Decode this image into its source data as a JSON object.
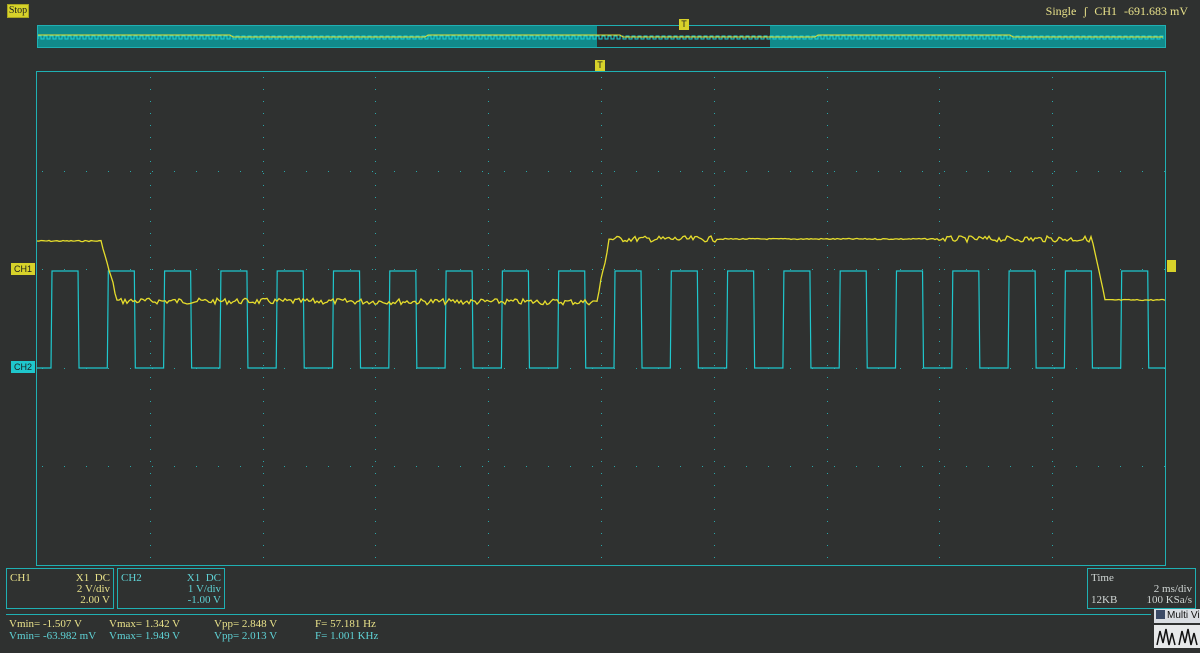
{
  "status": "Stop",
  "trigger": {
    "mode": "Single",
    "edge_icon": "rising-edge-icon",
    "source": "CH1",
    "level": "-691.683 mV"
  },
  "markers": {
    "trigger": "T",
    "ch1": "CH1",
    "ch2": "CH2"
  },
  "ch1": {
    "label": "CH1",
    "probe": "X1",
    "coupling": "DC",
    "scale": "2 V/div",
    "offset": "2.00 V",
    "color": "#e6dd2c"
  },
  "ch2": {
    "label": "CH2",
    "probe": "X1",
    "coupling": "DC",
    "scale": "1 V/div",
    "offset": "-1.00 V",
    "color": "#1fc7cc"
  },
  "time": {
    "label": "Time",
    "scale": "2 ms/div",
    "memory": "12KB",
    "sample_rate": "100 KSa/s"
  },
  "measurements": {
    "ch1": {
      "vmin": "Vmin= -1.507 V",
      "vmax": "Vmax= 1.342 V",
      "vpp": "Vpp= 2.848 V",
      "freq": "F= 57.181 Hz"
    },
    "ch2": {
      "vmin": "Vmin= -63.982 mV",
      "vmax": "Vmax= 1.949 V",
      "vpp": "Vpp= 2.013 V",
      "freq": "F= 1.001 KHz"
    }
  },
  "multi_button": "Multi Vi",
  "colors": {
    "background": "#2f3130",
    "grid": "#1fb0b3",
    "overview_fill": "#118a8b"
  }
}
